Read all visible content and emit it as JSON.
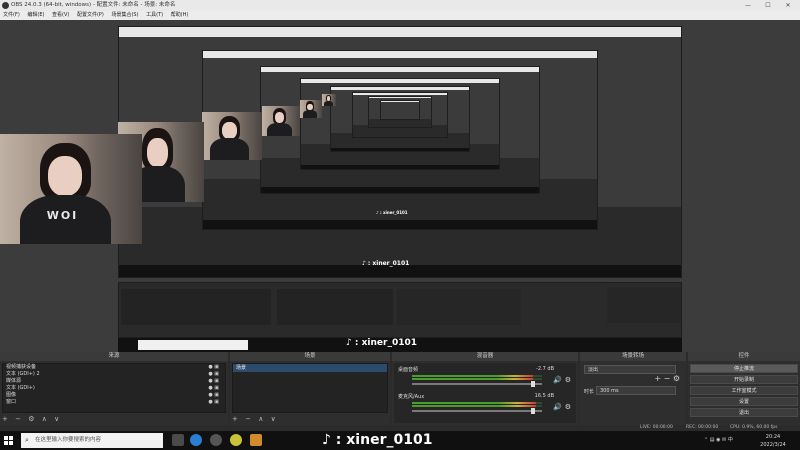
{
  "window": {
    "title": "OBS 24.0.3 (64-bit, windows) - 配置文件: 未命名 - 场景: 未命名",
    "controls": {
      "minimize": "—",
      "maximize": "☐",
      "close": "✕"
    }
  },
  "menu": [
    "文件(F)",
    "编辑(E)",
    "查看(V)",
    "配置文件(P)",
    "场景集合(S)",
    "工具(T)",
    "帮助(H)"
  ],
  "nested_title": "OBS 24.0.3 (64-bit, windows) - 配置文件: 未命名 - 场景: 未命名",
  "webcam_shirt_text": "WOI",
  "watermark": {
    "handle": "xiner_0101"
  },
  "docks": {
    "sources": {
      "title": "来源",
      "items": [
        "视频捕获设备",
        "文本 (GDI+) 2",
        "媒体源",
        "文本 (GDI+)",
        "图像",
        "窗口"
      ]
    },
    "scenes": {
      "title": "场景",
      "items": [
        "场景"
      ]
    },
    "mixer": {
      "title": "混音器",
      "channels": [
        {
          "name": "桌面音频",
          "db": "-2.7 dB",
          "level": 0.93,
          "volume": 0.93
        },
        {
          "name": "麦克风/Aux",
          "db": "16.5 dB",
          "level": 0.95,
          "volume": 0.93
        }
      ]
    },
    "transitions": {
      "title": "场景转场",
      "selected": "淡出",
      "duration_label": "时长",
      "duration_value": "300 ms"
    },
    "controls": {
      "title": "控件",
      "buttons": [
        "停止推流",
        "开始录制",
        "工作室模式",
        "设置",
        "退出"
      ]
    }
  },
  "footer_icons": {
    "add": "+",
    "remove": "−",
    "gear": "⚙",
    "up": "∧",
    "down": "∨"
  },
  "statusbar": {
    "live": "LIVE: 00:00:00",
    "rec": "REC: 00:00:00",
    "cpu": "CPU: 0.9%, 60.00 fps"
  },
  "taskbar": {
    "search_placeholder": "在这里输入你要搜索的内容",
    "time": "20:24",
    "date": "2022/3/24"
  },
  "colors": {
    "obs_bg": "#2b2b2b",
    "scene_selected": "#2c4a6a",
    "meter_green": "#4c9c2c",
    "meter_red": "#c83a3a"
  }
}
